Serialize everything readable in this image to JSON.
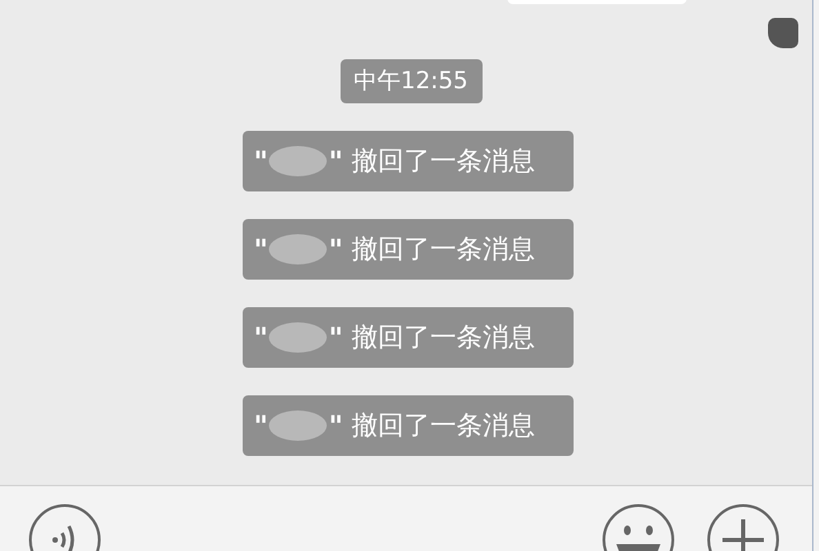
{
  "timestamp": "中午12:55",
  "messages": [
    {
      "open_quote": "\"",
      "close_quote": "\"",
      "text": "撤回了一条消息"
    },
    {
      "open_quote": "\"",
      "close_quote": "\"",
      "text": "撤回了一条消息"
    },
    {
      "open_quote": "\"",
      "close_quote": "\"",
      "text": "撤回了一条消息"
    },
    {
      "open_quote": "\"",
      "close_quote": "\"",
      "text": "撤回了一条消息"
    }
  ]
}
